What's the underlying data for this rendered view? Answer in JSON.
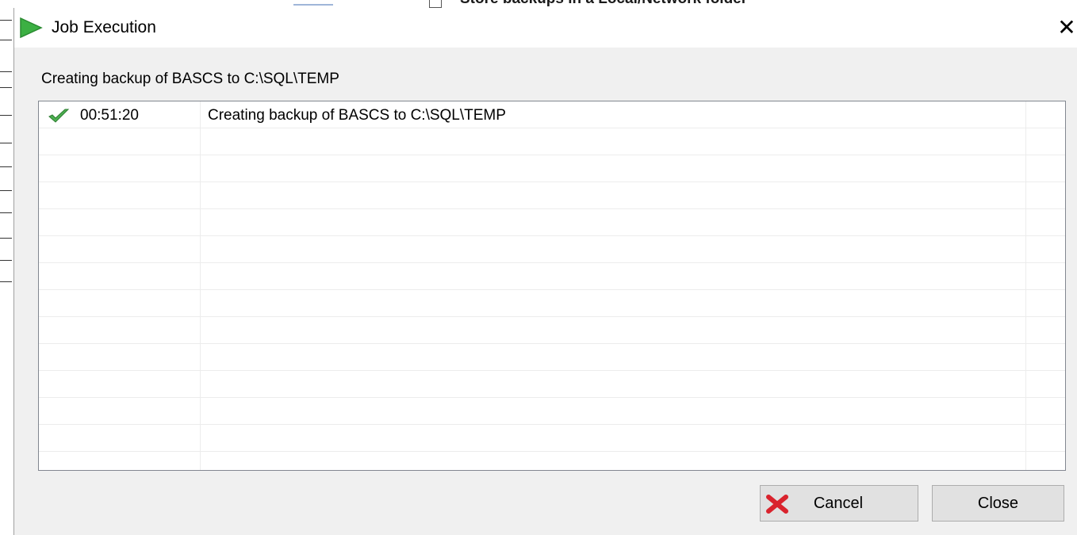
{
  "background": {
    "partial_heading": "Store backups in a Local/Network folder"
  },
  "dialog": {
    "title": "Job Execution",
    "title_icon": "play-icon",
    "close_glyph": "✕",
    "status_text": "Creating backup of BASCS to C:\\SQL\\TEMP",
    "log": {
      "rows": [
        {
          "status_icon": "check-icon",
          "time": "00:51:20",
          "message": "Creating backup of BASCS to C:\\SQL\\TEMP"
        }
      ]
    },
    "buttons": {
      "cancel_label": "Cancel",
      "cancel_icon": "red-x-icon",
      "close_label": "Close"
    }
  },
  "colors": {
    "play_green": "#3cb043",
    "check_green": "#4caf50",
    "cancel_red": "#d9232d",
    "button_bg": "#e1e1e1"
  }
}
